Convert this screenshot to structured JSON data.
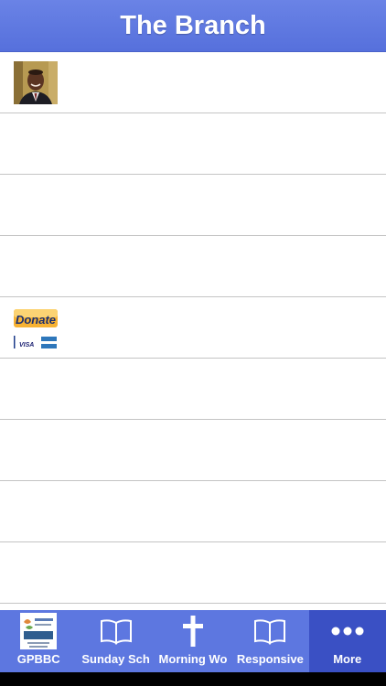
{
  "header": {
    "title": "The Branch"
  },
  "rows": [
    {
      "content": "pastor-photo"
    },
    {
      "content": ""
    },
    {
      "content": ""
    },
    {
      "content": ""
    },
    {
      "content": "donate-badge",
      "donate_label": "Donate",
      "card_label": "VISA"
    },
    {
      "content": ""
    },
    {
      "content": ""
    },
    {
      "content": ""
    },
    {
      "content": ""
    }
  ],
  "tabbar": {
    "tabs": [
      {
        "label": "GPBBC",
        "icon": "church-logo-icon"
      },
      {
        "label": "Sunday Sch",
        "icon": "book-icon"
      },
      {
        "label": "Morning Wo",
        "icon": "cross-icon"
      },
      {
        "label": "Responsive",
        "icon": "book-icon"
      },
      {
        "label": "More",
        "icon": "more-dots-icon",
        "active": true
      }
    ]
  },
  "colors": {
    "header": "#5d77e0",
    "tabbar": "#5d77e0",
    "tab_active": "#3a50c4",
    "divider": "#c4c4c4"
  }
}
